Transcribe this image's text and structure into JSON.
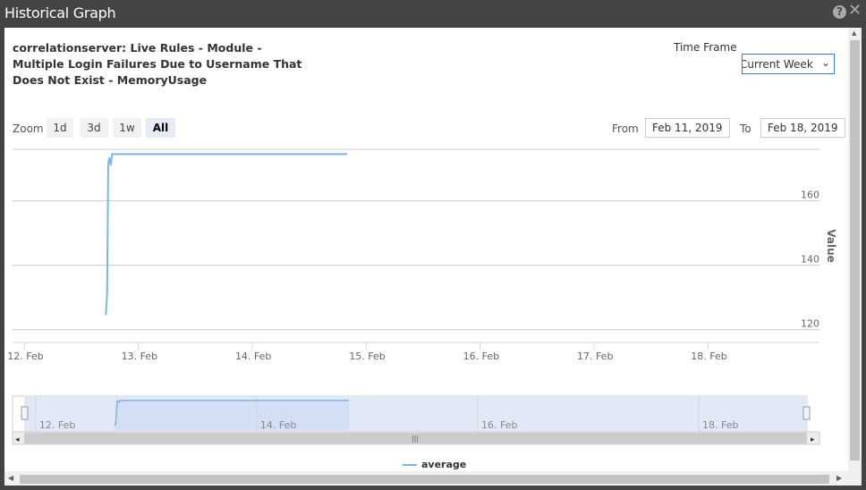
{
  "window": {
    "title": "Historical Graph",
    "help_icon": "help-icon",
    "close_icon": "close-icon"
  },
  "header": {
    "chart_title": "correlationserver: Live Rules - Module - Multiple Login Failures Due to Username That Does Not Exist - MemoryUsage",
    "time_frame_label": "Time Frame",
    "time_frame_value": "Current Week"
  },
  "zoom": {
    "label": "Zoom",
    "buttons": [
      "1d",
      "3d",
      "1w",
      "All"
    ],
    "active": "All"
  },
  "range": {
    "from_label": "From",
    "from_value": "Feb 11, 2019",
    "to_label": "To",
    "to_value": "Feb 18, 2019"
  },
  "legend": {
    "label": "average",
    "color": "#7cb5ec"
  },
  "chart_data": {
    "type": "line",
    "ylabel": "Value",
    "y_ticks": [
      120,
      140,
      160
    ],
    "ylim": [
      116,
      176
    ],
    "x_ticks": [
      "12. Feb",
      "13. Feb",
      "14. Feb",
      "15. Feb",
      "16. Feb",
      "17. Feb",
      "18. Feb"
    ],
    "xlim": [
      "2019-02-11T21:30",
      "2019-02-18T23:30"
    ],
    "grid": true,
    "series": [
      {
        "name": "average",
        "color": "#7cb5ec",
        "x": [
          "2019-02-12T17:10",
          "2019-02-12T17:25",
          "2019-02-12T17:40",
          "2019-02-12T17:55",
          "2019-02-12T18:10",
          "2019-02-12T18:30",
          "2019-02-14T20:00"
        ],
        "y": [
          124.5,
          131,
          171.5,
          173.5,
          171,
          174.5,
          174.5
        ]
      }
    ],
    "navigator": {
      "x_ticks": [
        "12. Feb",
        "14. Feb",
        "16. Feb",
        "18. Feb"
      ]
    }
  }
}
